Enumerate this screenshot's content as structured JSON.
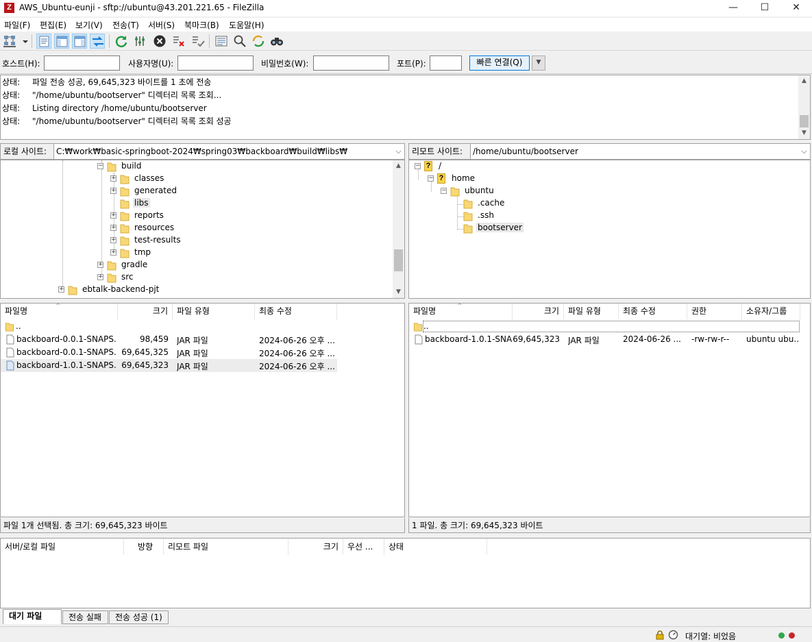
{
  "window": {
    "title": "AWS_Ubuntu-eunji - sftp://ubuntu@43.201.221.65 - FileZilla",
    "app_icon_letter": "Z",
    "minimize_glyph": "—",
    "maximize_glyph": "☐",
    "close_glyph": "✕"
  },
  "menu": {
    "items": [
      "파일(F)",
      "편집(E)",
      "보기(V)",
      "전송(T)",
      "서버(S)",
      "북마크(B)",
      "도움말(H)"
    ]
  },
  "toolbar": {
    "icons": [
      "site-manager-icon",
      "dropdown-arrow-icon",
      "toggle-message-log-icon",
      "toggle-local-tree-icon",
      "toggle-remote-tree-icon",
      "toggle-transfer-queue-icon",
      "refresh-icon",
      "process-queue-icon",
      "cancel-icon",
      "disconnect-icon",
      "reconnect-icon",
      "directory-filter-icon",
      "compare-directories-icon",
      "sync-browsing-icon",
      "search-icon"
    ]
  },
  "quickconnect": {
    "host_label": "호스트(H):",
    "user_label": "사용자명(U):",
    "pass_label": "비밀번호(W):",
    "port_label": "포트(P):",
    "host_value": "",
    "user_value": "",
    "pass_value": "",
    "port_value": "",
    "connect_button": "빠른 연결(Q)",
    "dropdown_glyph": "▼"
  },
  "log": {
    "lines": [
      {
        "key": "상태:",
        "text": "파일 전송 성공, 69,645,323 바이트를 1 초에 전송"
      },
      {
        "key": "상태:",
        "text": "\"/home/ubuntu/bootserver\" 디렉터리 목록 조회..."
      },
      {
        "key": "상태:",
        "text": "Listing directory /home/ubuntu/bootserver"
      },
      {
        "key": "상태:",
        "text": "\"/home/ubuntu/bootserver\" 디렉터리 목록 조회 성공"
      }
    ]
  },
  "local": {
    "site_label": "로컬 사이트:",
    "path": "C:₩work₩basic-springboot-2024₩spring03₩backboard₩build₩libs₩",
    "tree": [
      {
        "label": "build",
        "expander": "⊟"
      },
      {
        "label": "classes",
        "expander": "⊞"
      },
      {
        "label": "generated",
        "expander": "⊞"
      },
      {
        "label": "libs",
        "expander": ""
      },
      {
        "label": "reports",
        "expander": "⊞"
      },
      {
        "label": "resources",
        "expander": "⊞"
      },
      {
        "label": "test-results",
        "expander": "⊞"
      },
      {
        "label": "tmp",
        "expander": "⊞"
      },
      {
        "label": "gradle",
        "expander": "⊞"
      },
      {
        "label": "src",
        "expander": "⊞"
      },
      {
        "label": "ebtalk-backend-pjt",
        "expander": "⊞"
      }
    ],
    "columns": [
      "파일명",
      "크기",
      "파일 유형",
      "최종 수정"
    ],
    "files": [
      {
        "name": "..",
        "size": "",
        "type": "",
        "modified": ""
      },
      {
        "name": "backboard-0.0.1-SNAPS...",
        "size": "98,459",
        "type": "JAR 파일",
        "modified": "2024-06-26 오후 ..."
      },
      {
        "name": "backboard-0.0.1-SNAPS...",
        "size": "69,645,325",
        "type": "JAR 파일",
        "modified": "2024-06-26 오후 ..."
      },
      {
        "name": "backboard-1.0.1-SNAPS...",
        "size": "69,645,323",
        "type": "JAR 파일",
        "modified": "2024-06-26 오후 ..."
      }
    ],
    "status": "파일 1개 선택됨. 총 크기: 69,645,323 바이트"
  },
  "remote": {
    "site_label": "리모트 사이트:",
    "path": "/home/ubuntu/bootserver",
    "tree": [
      {
        "label": "/",
        "expander": "⊟"
      },
      {
        "label": "home",
        "expander": "⊟"
      },
      {
        "label": "ubuntu",
        "expander": "⊟"
      },
      {
        "label": ".cache",
        "expander": ""
      },
      {
        "label": ".ssh",
        "expander": ""
      },
      {
        "label": "bootserver",
        "expander": ""
      }
    ],
    "columns": [
      "파일명",
      "크기",
      "파일 유형",
      "최종 수정",
      "권한",
      "소유자/그룹"
    ],
    "files": [
      {
        "name": "..",
        "size": "",
        "type": "",
        "modified": "",
        "perm": "",
        "owner": ""
      },
      {
        "name": "backboard-1.0.1-SNA...",
        "size": "69,645,323",
        "type": "JAR 파일",
        "modified": "2024-06-26 ...",
        "perm": "-rw-rw-r--",
        "owner": "ubuntu ubu..."
      }
    ],
    "status": "1 파일. 총 크기: 69,645,323 바이트"
  },
  "queue": {
    "columns": [
      "서버/로컬 파일",
      "방향",
      "리모트 파일",
      "크기",
      "우선 ...",
      "상태"
    ],
    "tabs": [
      "대기 파일",
      "전송 실패",
      "전송 성공 (1)"
    ]
  },
  "statusbar": {
    "queue_text": "대기열: 비었음"
  },
  "colors": {
    "folder": "#f8d775",
    "selection": "#e8e8e8",
    "accent": "#0078d7",
    "led_green": "#2fa84f",
    "led_red": "#c62828"
  }
}
